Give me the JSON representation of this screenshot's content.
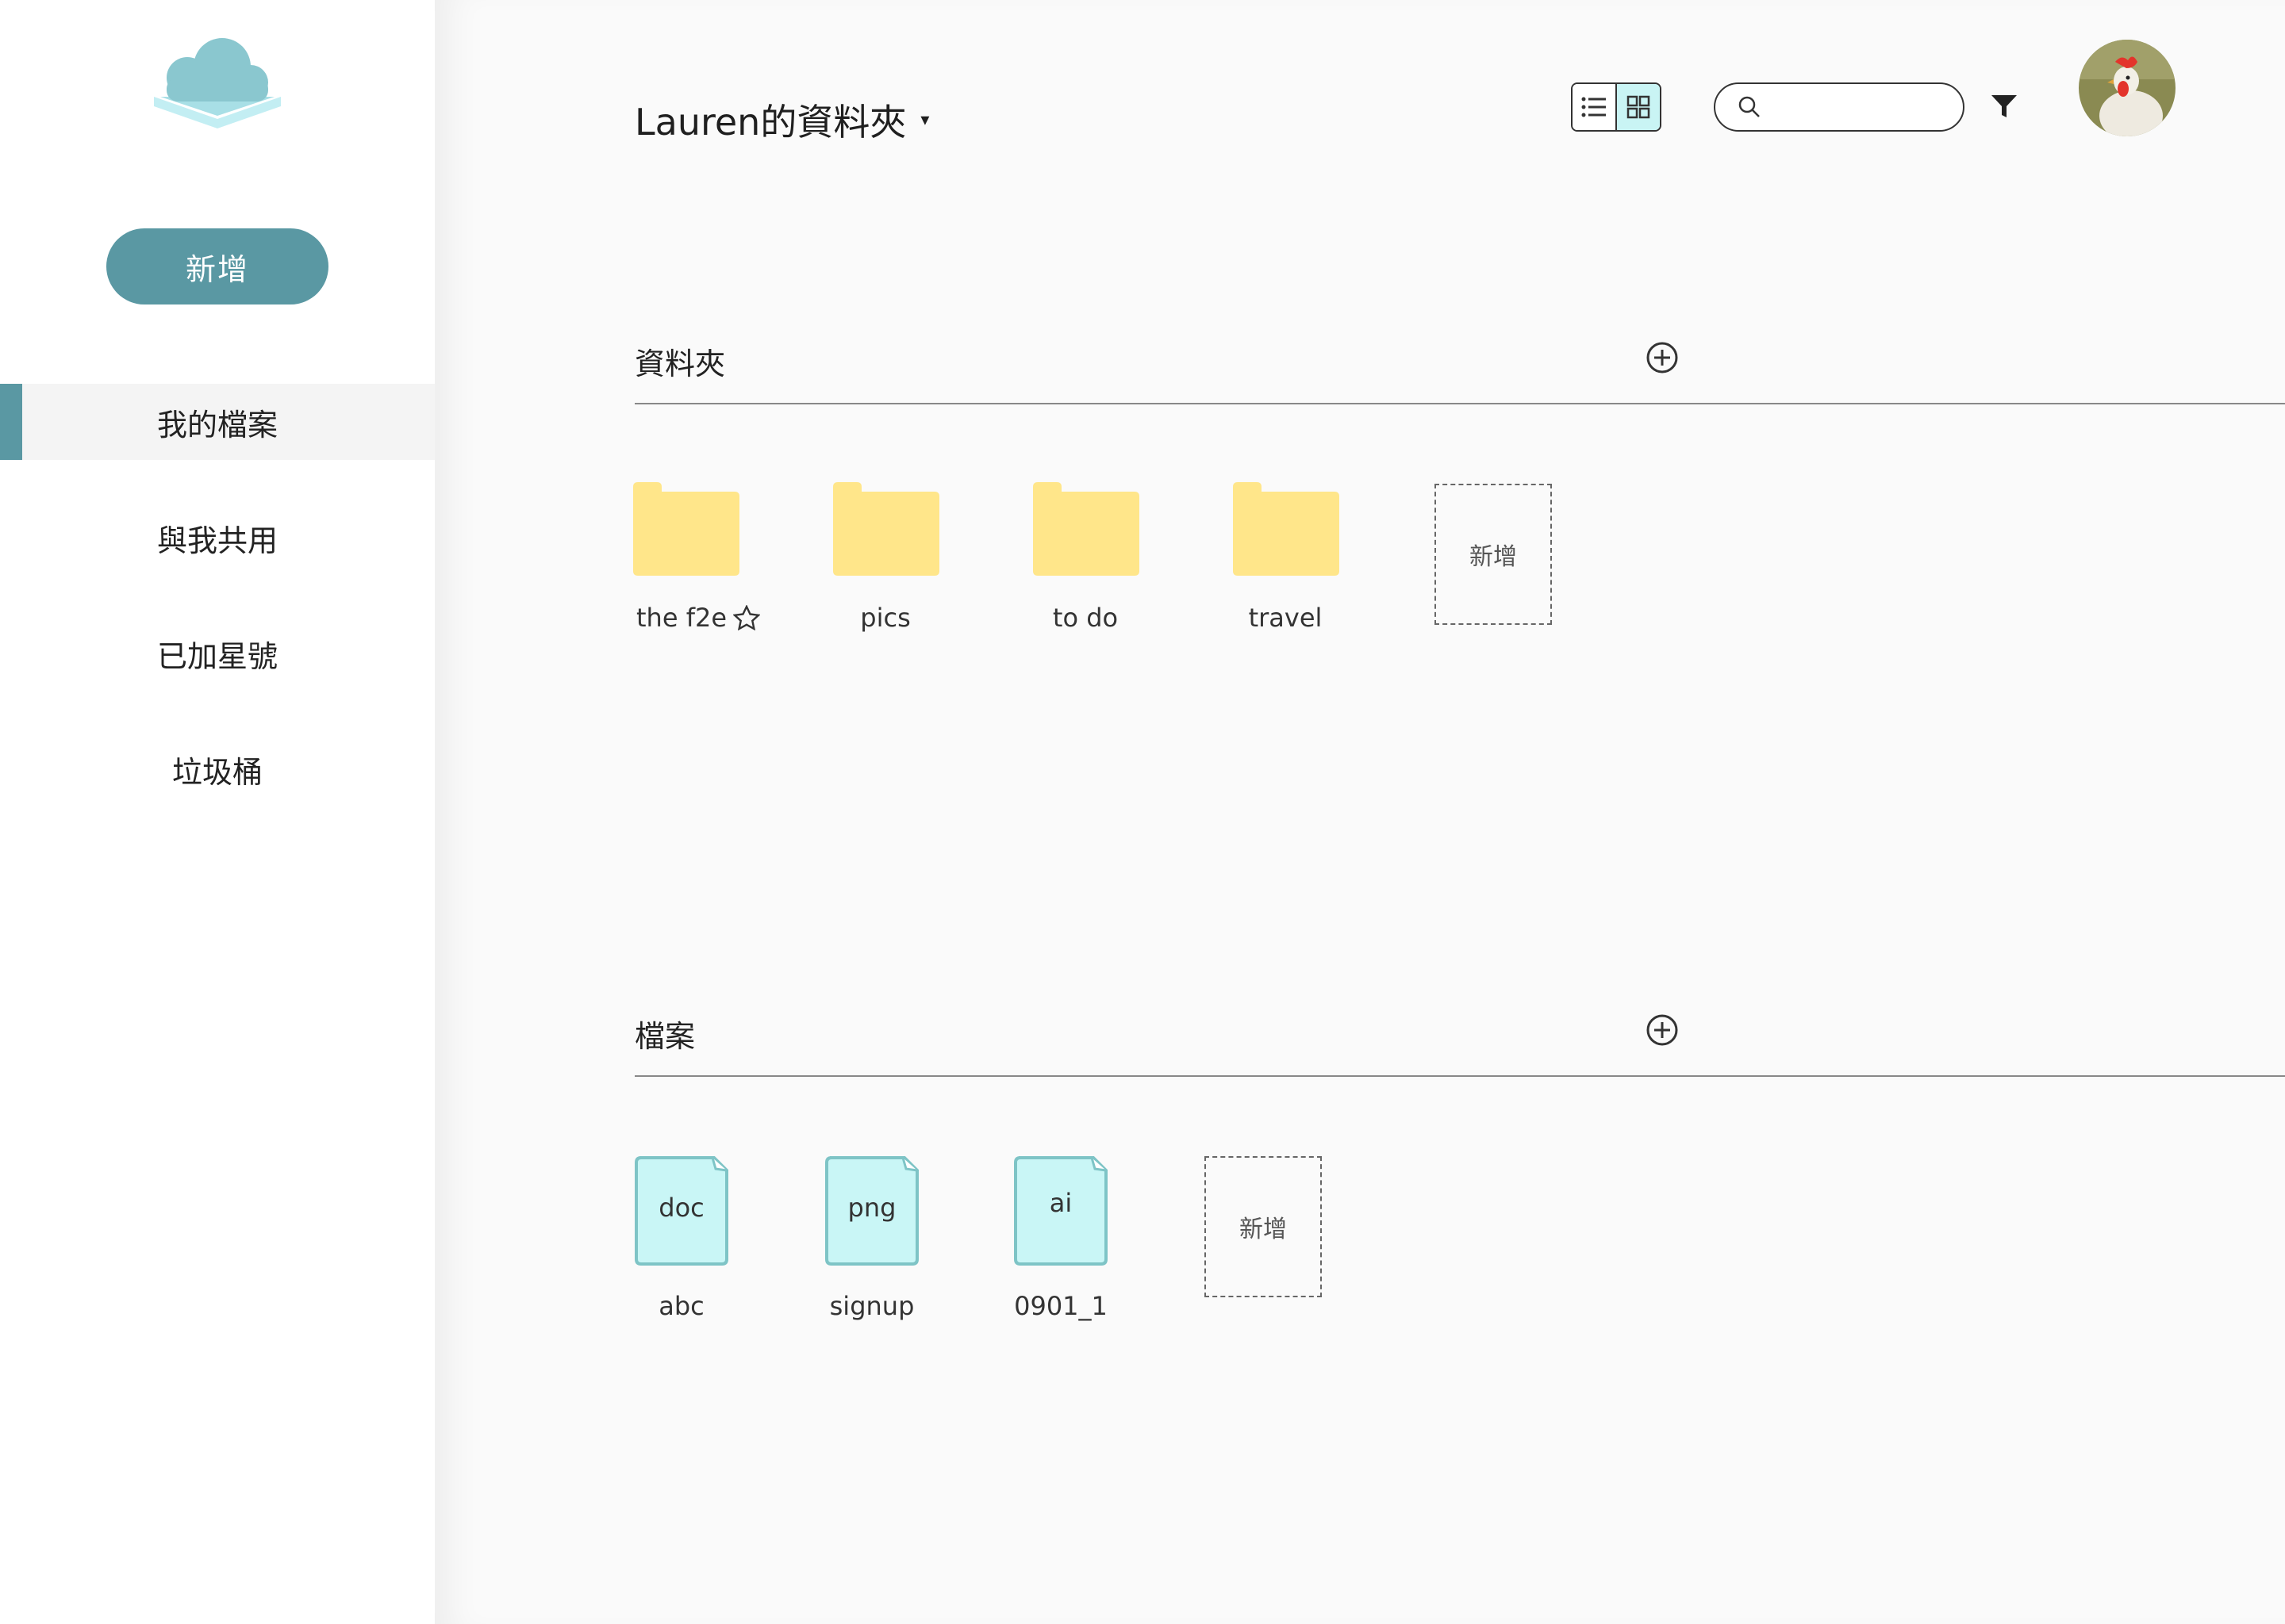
{
  "sidebar": {
    "logo": "cloud-logo",
    "new_button": "新增",
    "nav": [
      {
        "label": "我的檔案",
        "active": true
      },
      {
        "label": "與我共用",
        "active": false
      },
      {
        "label": "已加星號",
        "active": false
      },
      {
        "label": "垃圾桶",
        "active": false
      }
    ]
  },
  "header": {
    "title": "Lauren的資料夾",
    "title_caret": "▾",
    "view_mode": "grid",
    "search_placeholder": "",
    "filter_icon": "filter-icon",
    "avatar": "rooster-avatar"
  },
  "folders_section": {
    "label": "資料夾",
    "items": [
      {
        "name": "the f2e",
        "starred": true
      },
      {
        "name": "pics",
        "starred": false
      },
      {
        "name": "to do",
        "starred": false
      },
      {
        "name": "travel",
        "starred": false
      }
    ],
    "add_label": "新增"
  },
  "files_section": {
    "label": "檔案",
    "items": [
      {
        "ext": "doc",
        "name": "abc"
      },
      {
        "ext": "png",
        "name": "signup"
      },
      {
        "ext": "ai",
        "name": "0901_1"
      }
    ],
    "add_label": "新增"
  },
  "colors": {
    "accent": "#5a98a3",
    "folder": "#ffe68a",
    "file": "#c9f6f6",
    "file_border": "#7ec4c6",
    "logo_dark": "#8ac7cf",
    "logo_light": "#c3eef3"
  }
}
